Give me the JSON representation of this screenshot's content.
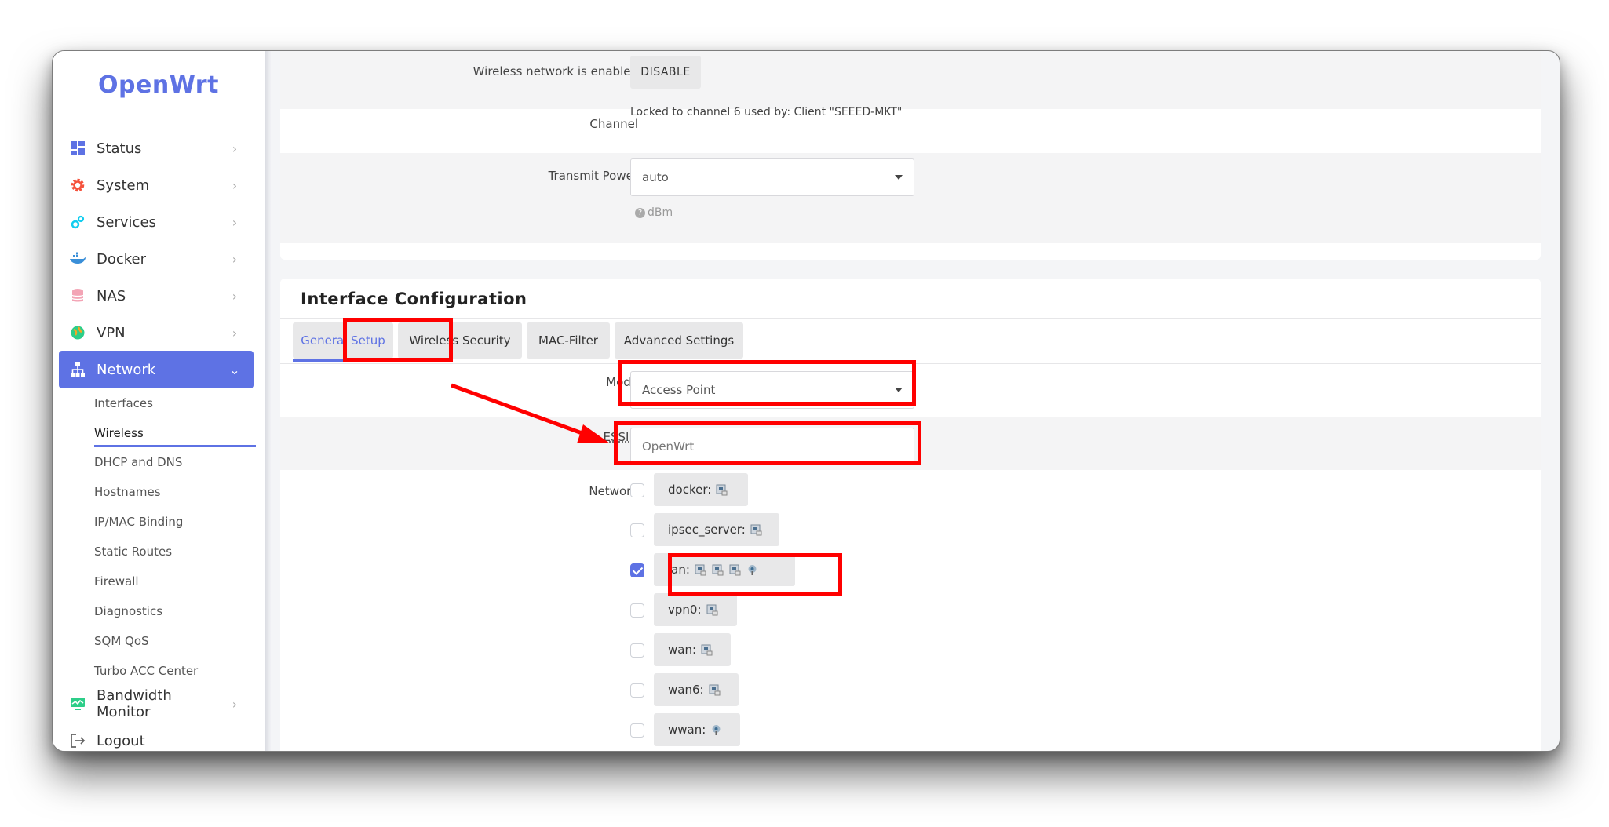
{
  "brand": "OpenWrt",
  "sidebar": {
    "items": [
      {
        "label": "Status",
        "icon": "dashboard-icon"
      },
      {
        "label": "System",
        "icon": "gear-icon"
      },
      {
        "label": "Services",
        "icon": "gears-icon"
      },
      {
        "label": "Docker",
        "icon": "docker-whale-icon"
      },
      {
        "label": "NAS",
        "icon": "database-icon"
      },
      {
        "label": "VPN",
        "icon": "globe-icon"
      },
      {
        "label": "Network",
        "icon": "sitemap-icon",
        "active": true
      },
      {
        "label": "Bandwidth Monitor",
        "icon": "monitor-chart-icon"
      },
      {
        "label": "Logout",
        "icon": "logout-icon"
      }
    ],
    "network_sub": [
      "Interfaces",
      "Wireless",
      "DHCP and DNS",
      "Hostnames",
      "IP/MAC Binding",
      "Static Routes",
      "Firewall",
      "Diagnostics",
      "SQM QoS",
      "Turbo ACC Center"
    ],
    "current_sub": "Wireless"
  },
  "device": {
    "enabled_label": "Wireless network is enabled",
    "disable_button": "DISABLE",
    "channel_label": "Channel",
    "channel_value": "Locked to channel 6 used by: Client \"SEEED-MKT\"",
    "txpower_label": "Transmit Power",
    "txpower_value": "auto",
    "txpower_hint": "dBm"
  },
  "iface": {
    "title": "Interface Configuration",
    "tabs": [
      "General Setup",
      "Wireless Security",
      "MAC-Filter",
      "Advanced Settings"
    ],
    "mode_label": "Mode",
    "mode_value": "Access Point",
    "essid_label": "ESSID",
    "essid_value": "OpenWrt",
    "network_label": "Network",
    "networks": [
      {
        "name": "docker:",
        "checked": false,
        "icons": [
          "ethernet-port-icon"
        ]
      },
      {
        "name": "ipsec_server:",
        "checked": false,
        "icons": [
          "ethernet-port-icon"
        ]
      },
      {
        "name": "lan:",
        "checked": true,
        "icons": [
          "ethernet-port-icon",
          "ethernet-port-icon",
          "ethernet-port-icon",
          "wifi-antenna-icon"
        ]
      },
      {
        "name": "vpn0:",
        "checked": false,
        "icons": [
          "ethernet-port-icon"
        ]
      },
      {
        "name": "wan:",
        "checked": false,
        "icons": [
          "ethernet-port-icon"
        ]
      },
      {
        "name": "wan6:",
        "checked": false,
        "icons": [
          "ethernet-port-icon"
        ]
      },
      {
        "name": "wwan:",
        "checked": false,
        "icons": [
          "wifi-antenna-icon"
        ]
      }
    ]
  },
  "colors": {
    "accent": "#5e72e4",
    "highlight": "#ff0000"
  }
}
